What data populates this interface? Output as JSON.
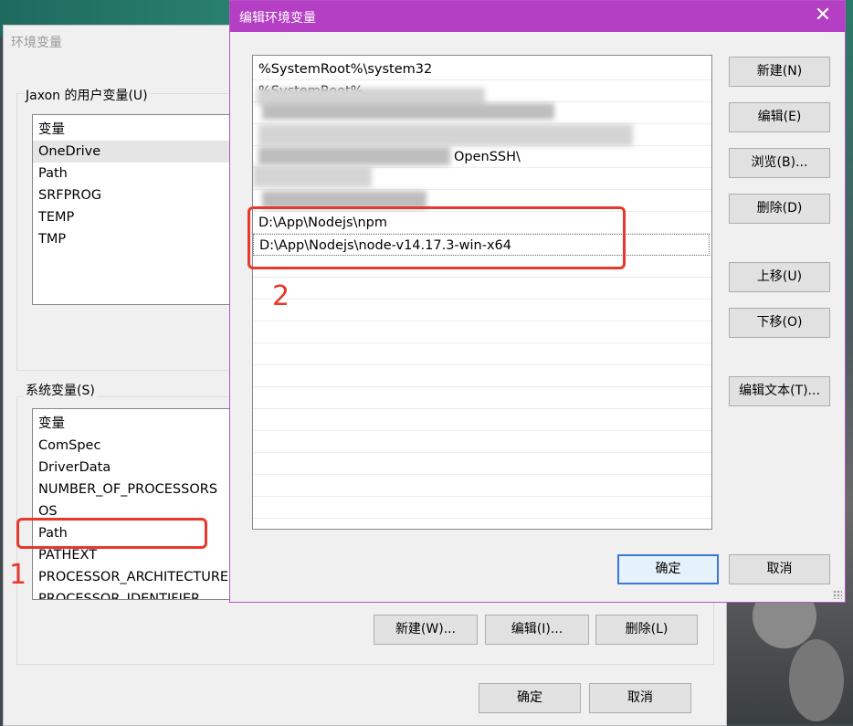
{
  "env_window": {
    "title": "环境变量",
    "user_group_label": "Jaxon 的用户变量(U)",
    "user_vars": [
      "变量",
      "OneDrive",
      "Path",
      "SRFPROG",
      "TEMP",
      "TMP"
    ],
    "system_group_label": "系统变量(S)",
    "system_vars": [
      "变量",
      "ComSpec",
      "DriverData",
      "NUMBER_OF_PROCESSORS",
      "OS",
      "Path",
      "PATHEXT",
      "PROCESSOR_ARCHITECTURE",
      "PROCESSOR_IDENTIFIER"
    ],
    "new_button": "新建(W)...",
    "edit_button": "编辑(I)...",
    "delete_button": "删除(L)",
    "ok_button": "确定",
    "cancel_button": "取消"
  },
  "edit_dialog": {
    "title": "编辑环境变量",
    "close_icon": "close-icon",
    "paths": {
      "first": "%SystemRoot%\\system32",
      "second_partial": "%SystemRoot%",
      "partial_fragment": "OpenSSH\\",
      "npm": "D:\\App\\Nodejs\\npm",
      "node": "D:\\App\\Nodejs\\node-v14.17.3-win-x64"
    },
    "buttons": {
      "new": "新建(N)",
      "edit": "编辑(E)",
      "browse": "浏览(B)...",
      "delete": "删除(D)",
      "move_up": "上移(U)",
      "move_down": "下移(O)",
      "edit_text": "编辑文本(T)...",
      "ok": "确定",
      "cancel": "取消"
    }
  },
  "annotations": {
    "label_1": "1",
    "label_2": "2",
    "color": "#e8382c"
  }
}
